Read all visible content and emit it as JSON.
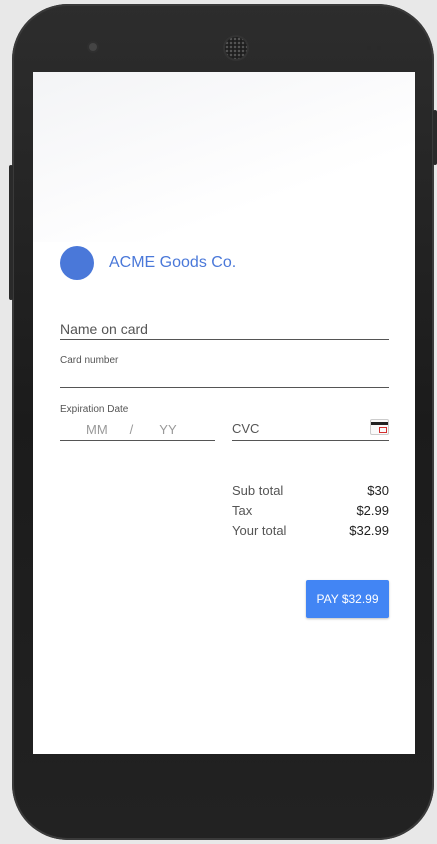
{
  "merchant": {
    "name": "ACME Goods Co.",
    "logo_color": "#4a78d9"
  },
  "form": {
    "name_placeholder": "Name on card",
    "card_number_label": "Card number",
    "expiration_label": "Expiration Date",
    "month_placeholder": "MM",
    "separator": "/",
    "year_placeholder": "YY",
    "cvc_placeholder": "CVC",
    "cvc_icon": "card-cvc-icon"
  },
  "totals": [
    {
      "label": "Sub total",
      "value": "$30"
    },
    {
      "label": "Tax",
      "value": "$2.99"
    },
    {
      "label": "Your total",
      "value": "$32.99"
    }
  ],
  "pay_button": {
    "label": "PAY $32.99",
    "color": "#4285f4"
  }
}
